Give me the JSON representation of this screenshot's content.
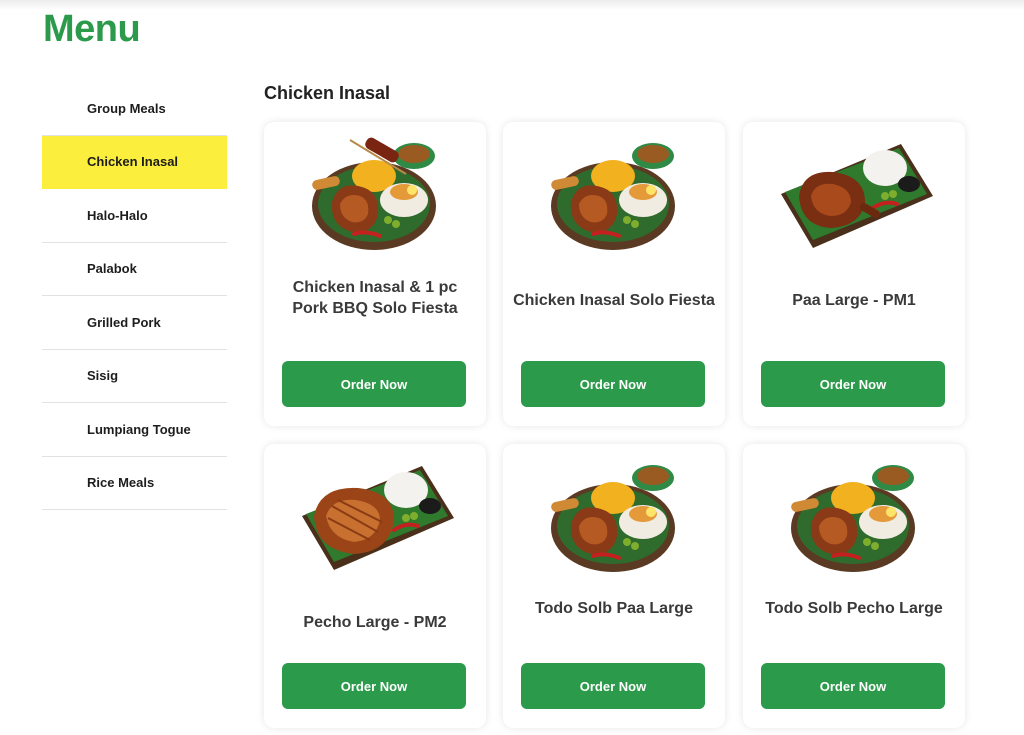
{
  "page_title": "Menu",
  "sidebar": {
    "items": [
      {
        "label": "Group Meals"
      },
      {
        "label": "Chicken Inasal",
        "active": true
      },
      {
        "label": "Halo-Halo"
      },
      {
        "label": "Palabok"
      },
      {
        "label": "Grilled Pork"
      },
      {
        "label": "Sisig"
      },
      {
        "label": "Lumpiang Togue"
      },
      {
        "label": "Rice Meals"
      }
    ]
  },
  "section_title": "Chicken Inasal",
  "products": [
    {
      "name": "Chicken Inasal & 1 pc Pork BBQ Solo Fiesta",
      "button": "Order Now",
      "image": "round-plate-with-bbq-icon"
    },
    {
      "name": "Chicken Inasal Solo Fiesta",
      "button": "Order Now",
      "image": "round-plate-icon"
    },
    {
      "name": "Paa Large - PM1",
      "button": "Order Now",
      "image": "tray-chicken-leg-icon"
    },
    {
      "name": "Pecho Large - PM2",
      "button": "Order Now",
      "image": "tray-chicken-breast-icon"
    },
    {
      "name": "Todo Solb Paa Large",
      "button": "Order Now",
      "image": "round-plate-icon"
    },
    {
      "name": "Todo Solb Pecho Large",
      "button": "Order Now",
      "image": "round-plate-icon"
    }
  ],
  "colors": {
    "brand_green": "#2b9a4a",
    "active_yellow": "#fbee3c"
  }
}
